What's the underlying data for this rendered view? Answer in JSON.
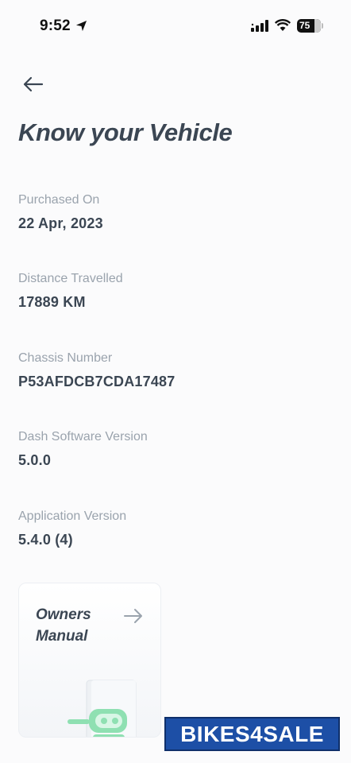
{
  "status_bar": {
    "time": "9:52",
    "battery_level": "75"
  },
  "header": {
    "title": "Know your Vehicle"
  },
  "vehicle_info": [
    {
      "label": "Purchased On",
      "value": "22 Apr, 2023"
    },
    {
      "label": "Distance Travelled",
      "value": "17889 KM"
    },
    {
      "label": "Chassis Number",
      "value": "P53AFDCB7CDA17487"
    },
    {
      "label": "Dash Software Version",
      "value": "5.0.0"
    },
    {
      "label": "Application Version",
      "value": "5.4.0 (4)"
    }
  ],
  "manual_card": {
    "title": "Owners Manual"
  },
  "watermark": {
    "text": "BIKES4SALE"
  },
  "colors": {
    "background": "#fbfbfc",
    "text_primary": "#3b4653",
    "text_secondary": "#9aa3ad",
    "illustration_accent": "#8fe0b2",
    "watermark_bg": "#1d4fa6"
  }
}
